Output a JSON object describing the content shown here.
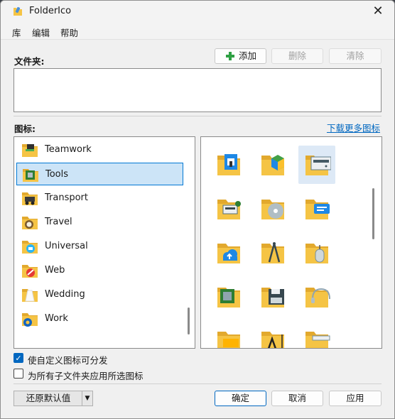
{
  "window": {
    "title": "FolderIco",
    "close_glyph": "✕"
  },
  "menu": {
    "items": [
      "库",
      "编辑",
      "帮助"
    ]
  },
  "folders": {
    "label": "文件夹:",
    "add_label": "添加",
    "delete_label": "删除",
    "clear_label": "清除"
  },
  "icons_section": {
    "label": "图标:",
    "download_link": "下载更多图标"
  },
  "libraries": {
    "items": [
      {
        "label": "Teamwork",
        "selected": false
      },
      {
        "label": "Tools",
        "selected": true
      },
      {
        "label": "Transport",
        "selected": false
      },
      {
        "label": "Travel",
        "selected": false
      },
      {
        "label": "Universal",
        "selected": false
      },
      {
        "label": "Web",
        "selected": false
      },
      {
        "label": "Wedding",
        "selected": false
      },
      {
        "label": "Work",
        "selected": false
      }
    ]
  },
  "icon_grid": {
    "items": [
      "3d-printer-folder-icon",
      "cube-folder-icon",
      "server-folder-icon",
      "computer-folder-icon",
      "cd-folder-icon",
      "chat-folder-icon",
      "cloud-upload-folder-icon",
      "compass-folder-icon",
      "mouse-folder-icon",
      "chip-folder-icon",
      "floppy-folder-icon",
      "headphones-folder-icon",
      "folder-folder-icon",
      "font-folder-icon",
      "ruler-folder-icon"
    ],
    "selected_index": 2
  },
  "options": {
    "distributable_label": "使自定义图标可分发",
    "distributable_checked": true,
    "apply_subfolders_label": "为所有子文件夹应用所选图标",
    "apply_subfolders_checked": false
  },
  "footer": {
    "restore_label": "还原默认值",
    "ok_label": "确定",
    "cancel_label": "取消",
    "apply_label": "应用"
  },
  "colors": {
    "accent": "#0067c0",
    "folder": "#f5c445",
    "folder_back": "#e2a92e",
    "selection": "#cce4f7"
  }
}
